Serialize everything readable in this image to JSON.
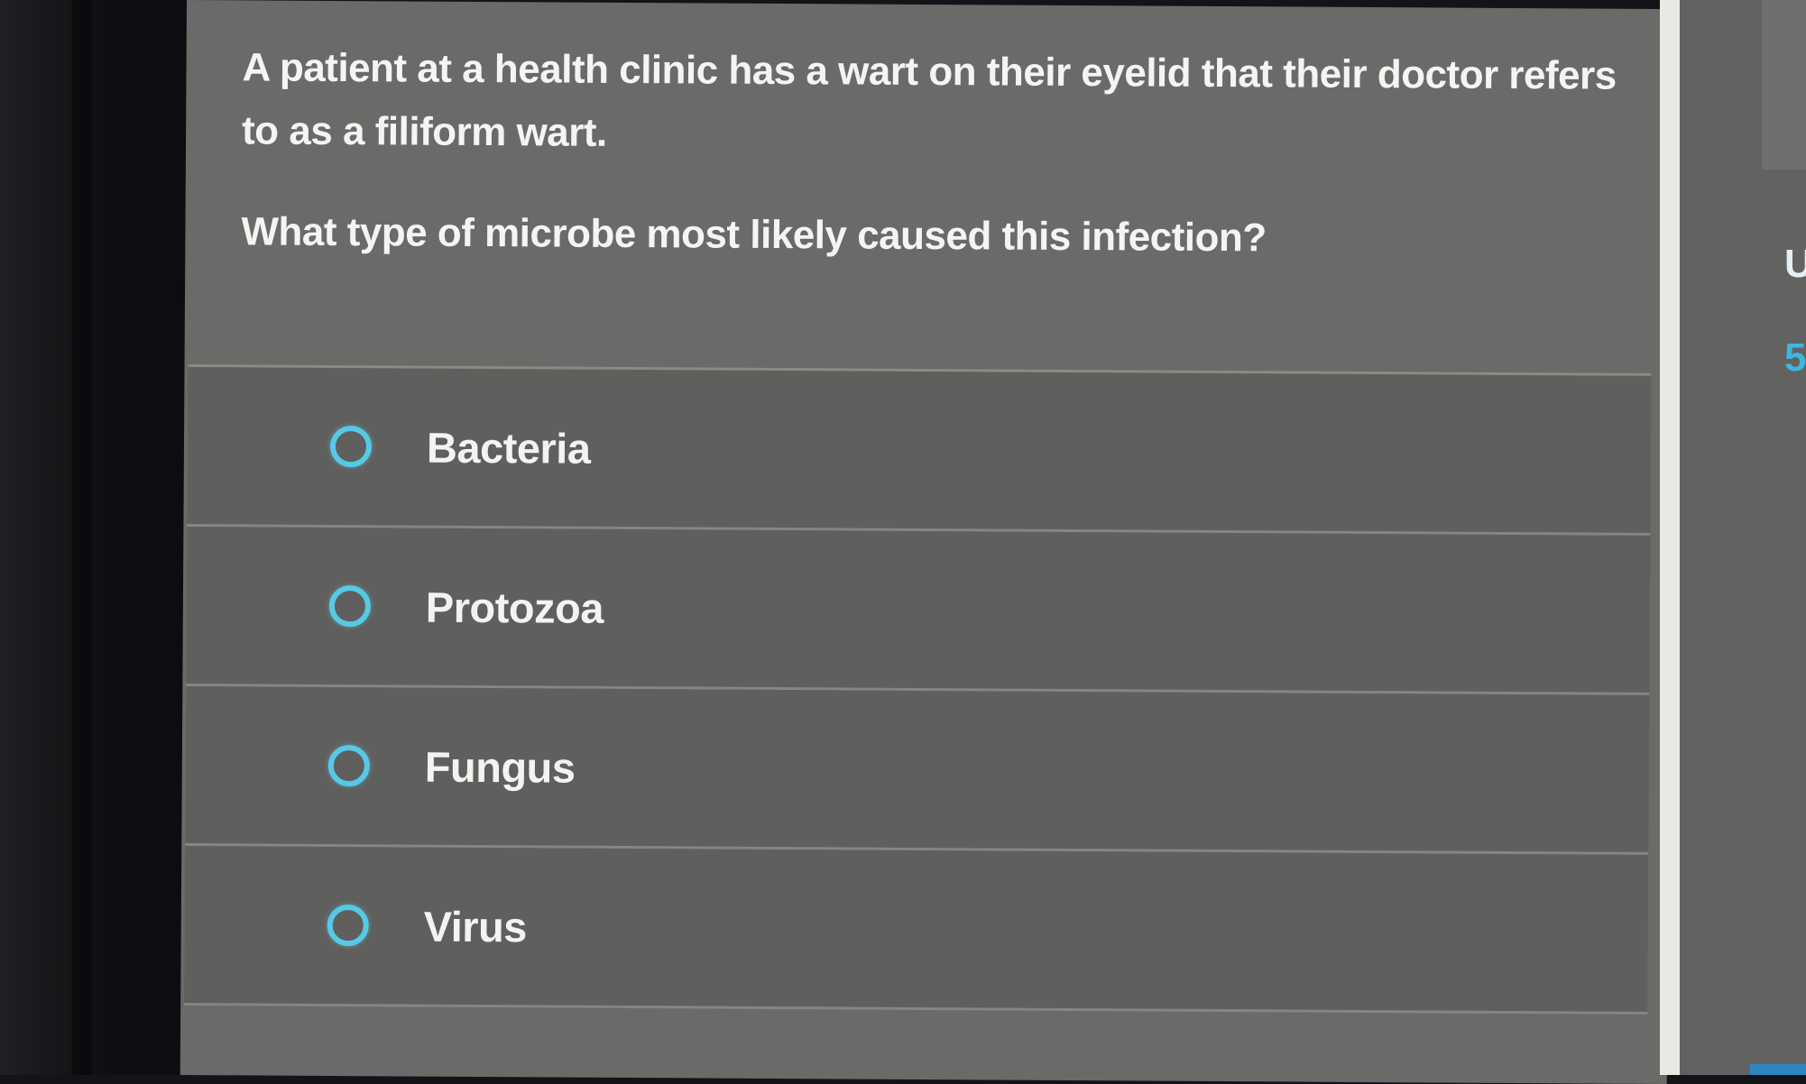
{
  "question": {
    "stem": "A patient at a health clinic has a wart on their eyelid that their doctor refers to as a filiform wart.",
    "prompt": "What type of microbe most likely caused this infection?"
  },
  "options": [
    {
      "label": "Bacteria",
      "selected": false
    },
    {
      "label": "Protozoa",
      "selected": false
    },
    {
      "label": "Fungus",
      "selected": false
    },
    {
      "label": "Virus",
      "selected": false
    }
  ],
  "sidebar": {
    "partial_text_top": "U",
    "partial_text_number": "5"
  },
  "colors": {
    "panel": "#6a6a68",
    "option_row": "#5f5f5d",
    "radio_ring": "#56c9e6",
    "text": "#f4f4f2"
  }
}
